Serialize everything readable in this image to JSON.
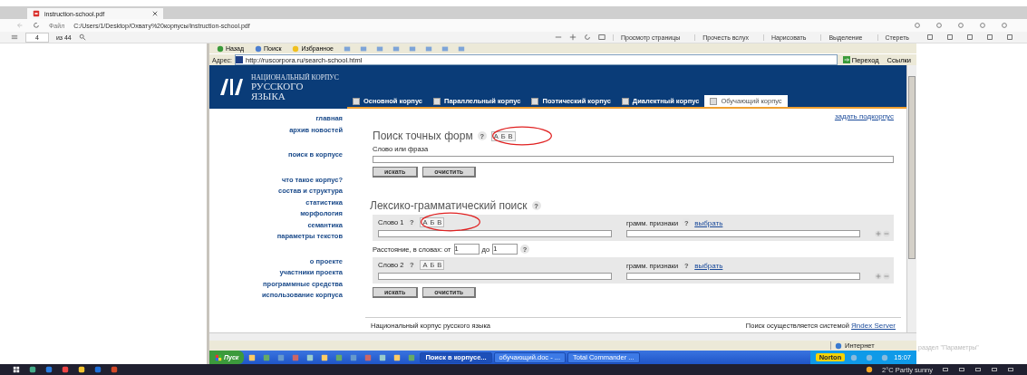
{
  "browser": {
    "tab": {
      "title": "instruction-school.pdf"
    },
    "address": {
      "prefix": "Файл",
      "url": "C:/Users/1/Desktop/Охвату%20корпусы/instruction-school.pdf"
    },
    "pdf_toolbar": {
      "page": "4",
      "page_count": "из 44",
      "tools": [
        {
          "label": "Просмотр страницы"
        },
        {
          "label": "Прочесть вслух"
        },
        {
          "label": "Нарисовать"
        },
        {
          "label": "Выделение"
        },
        {
          "label": "Стереть"
        }
      ]
    }
  },
  "ie": {
    "buttons": [
      {
        "label": "Назад"
      },
      {
        "label": "Поиск"
      },
      {
        "label": "Избранное"
      }
    ],
    "address_label": "Адрес:",
    "url": "http://ruscorpora.ru/search-school.html",
    "go": "Переход",
    "links": "Ссылки"
  },
  "site": {
    "logo_lines": [
      "НАЦИОНАЛЬНЫЙ КОРПУС",
      "РУССКОГО",
      "ЯЗЫКА"
    ],
    "tabs": [
      {
        "label": "Основной корпус",
        "selected": false
      },
      {
        "label": "Параллельный корпус",
        "selected": false
      },
      {
        "label": "Поэтический корпус",
        "selected": false
      },
      {
        "label": "Диалектный корпус",
        "selected": false
      },
      {
        "label": "Обучающий корпус",
        "selected": true
      }
    ],
    "nav": [
      [
        "главная",
        "архив новостей"
      ],
      [
        "поиск в корпусе"
      ],
      [
        "что такое корпус?",
        "состав и структура",
        "статистика",
        "морфология",
        "семантика",
        "параметры текстов"
      ],
      [
        "о проекте",
        "участники проекта",
        "программные средства",
        "использование корпуса"
      ]
    ],
    "subcorpus_link": "задать подкорпус",
    "exact": {
      "title": "Поиск точных форм",
      "help": "?",
      "keyboard": [
        "А",
        "Б",
        "В"
      ],
      "annotated": true,
      "field_label": "Слово или фраза",
      "buttons": [
        "искать",
        "очистить"
      ]
    },
    "lexgram": {
      "title": "Лексико-грамматический поиск",
      "help": "?",
      "words": [
        {
          "label": "Слово 1",
          "help": "?",
          "keyboard": [
            "А",
            "Б",
            "В"
          ],
          "annotated": true,
          "gram_label": "грамм. признаки",
          "gram_help": "?",
          "gram_link": "выбрать"
        },
        {
          "label": "Слово 2",
          "help": "?",
          "keyboard": [
            "А",
            "Б",
            "В"
          ],
          "annotated": false,
          "gram_label": "грамм. признаки",
          "gram_help": "?",
          "gram_link": "выбрать"
        }
      ],
      "distance": {
        "label": "Расстояние, в словах: от",
        "from": "1",
        "to_label": "до",
        "to": "1",
        "help": "?"
      },
      "buttons": [
        "искать",
        "очистить"
      ]
    },
    "footer": {
      "left": "Национальный корпус русского языка",
      "right": "Поиск осуществляется системой",
      "link": "Яndex Server"
    }
  },
  "ie_status": {
    "zone": "Интернет"
  },
  "xp_taskbar": {
    "start": "Пуск",
    "tasks": [
      {
        "label": "Поиск в корпусе...",
        "selected": true
      },
      {
        "label": "обучающий.doc - ...",
        "selected": false
      },
      {
        "label": "Total Commander ...",
        "selected": false
      }
    ],
    "norton": "Norton",
    "clock": "15:07"
  },
  "side_note": "раздел \"Параметры\"",
  "windows_taskbar": {
    "weather": "2°C  Partly sunny"
  }
}
